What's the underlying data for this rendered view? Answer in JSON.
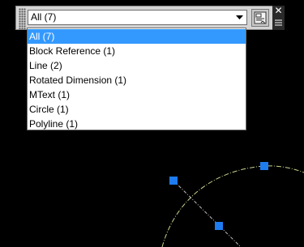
{
  "filter": {
    "selected_value": "All (7)",
    "options": [
      "All (7)",
      "Block Reference (1)",
      "Line (2)",
      "Rotated Dimension (1)",
      "MText (1)",
      "Circle (1)",
      "Polyline (1)"
    ]
  },
  "icons": {
    "grip": "grip-handle-icon",
    "dropdown_arrow": "chevron-down-icon",
    "quick_select": "quick-select-icon",
    "close": "close-icon",
    "properties": "properties-menu-icon"
  },
  "colors": {
    "canvas": "#000000",
    "selection_highlight": "#3399ff",
    "grip_blue": "#1e7cf0",
    "circle_stroke": "#c8d48c"
  }
}
